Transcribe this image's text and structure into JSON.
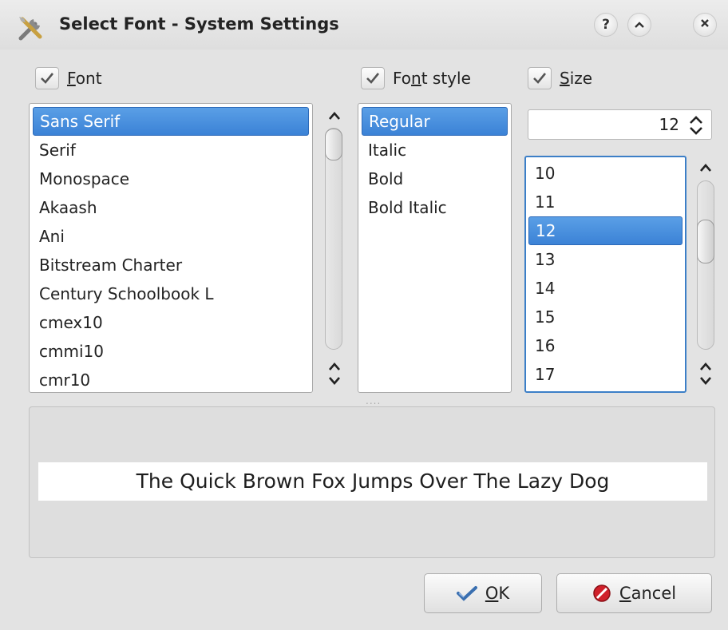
{
  "window": {
    "title": "Select Font - System Settings",
    "help_label": "?"
  },
  "checkboxes": {
    "font": {
      "pre": "",
      "u": "F",
      "post": "ont",
      "checked": true
    },
    "style": {
      "pre": "Fo",
      "u": "n",
      "post": "t style",
      "checked": true
    },
    "size": {
      "pre": "",
      "u": "S",
      "post": "ize",
      "checked": true
    }
  },
  "font_list": {
    "items": [
      "Sans Serif",
      "Serif",
      "Monospace",
      "Akaash",
      "Ani",
      "Bitstream Charter",
      "Century Schoolbook L",
      "cmex10",
      "cmmi10",
      "cmr10"
    ],
    "selected": "Sans Serif"
  },
  "style_list": {
    "items": [
      "Regular",
      "Italic",
      "Bold",
      "Bold Italic"
    ],
    "selected": "Regular"
  },
  "size_spin": {
    "value": "12"
  },
  "size_list": {
    "items": [
      "10",
      "11",
      "12",
      "13",
      "14",
      "15",
      "16",
      "17"
    ],
    "selected": "12"
  },
  "preview": {
    "text": "The Quick Brown Fox Jumps Over The Lazy Dog"
  },
  "splitter_label": "....",
  "buttons": {
    "ok": {
      "pre": "",
      "u": "O",
      "post": "K"
    },
    "cancel": {
      "pre": "",
      "u": "C",
      "post": "ancel"
    }
  },
  "colors": {
    "selection": "#3b82d6",
    "focus_border": "#3c7fc7",
    "ok_check": "#3a6fb0",
    "cancel_red": "#d0202a"
  },
  "icons": [
    "settings-tools-icon",
    "help-icon",
    "minimize-icon",
    "close-icon",
    "checkmark-icon",
    "scroll-up-icon",
    "scroll-updown-icon",
    "spin-updown-icon",
    "ok-check-icon",
    "cancel-icon"
  ]
}
